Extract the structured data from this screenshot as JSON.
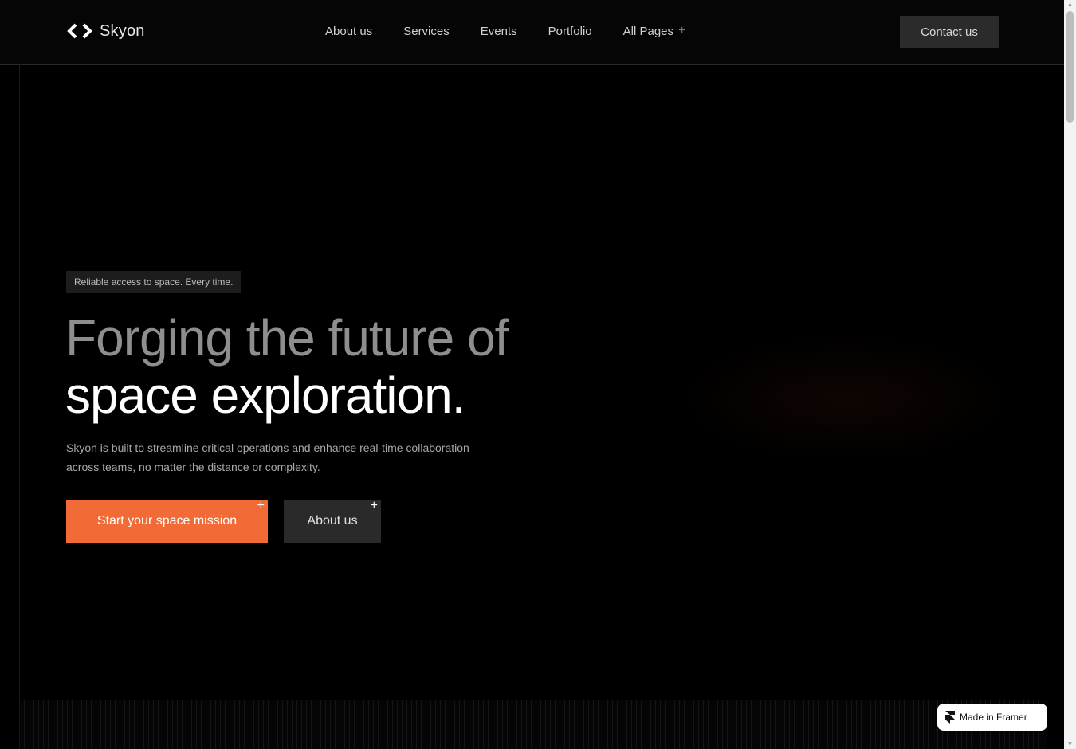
{
  "brand": {
    "name": "Skyon",
    "logo_icon": "code-brackets-icon"
  },
  "nav": {
    "items": [
      {
        "label": "About us"
      },
      {
        "label": "Services"
      },
      {
        "label": "Events"
      },
      {
        "label": "Portfolio"
      },
      {
        "label": "All Pages",
        "icon": "plus-icon",
        "icon_glyph": "+"
      }
    ],
    "contact_label": "Contact us"
  },
  "hero": {
    "eyebrow": "Reliable access to space. Every time.",
    "headline_line1": "Forging the future of",
    "headline_line2": "space exploration.",
    "description": "Skyon is built to streamline critical operations and enhance real-time collaboration across teams, no matter the distance or complexity.",
    "primary_cta": "Start your space mission",
    "secondary_cta": "About us",
    "cta_plus_glyph": "+"
  },
  "badge": {
    "label": "Made in Framer",
    "icon": "framer-icon"
  },
  "colors": {
    "background": "#000000",
    "accent": "#f26a36",
    "button_dark": "#2a2a2a",
    "muted_text": "#8e8e8e"
  },
  "scrollbar": {
    "up_glyph": "▲",
    "down_glyph": "▼"
  }
}
